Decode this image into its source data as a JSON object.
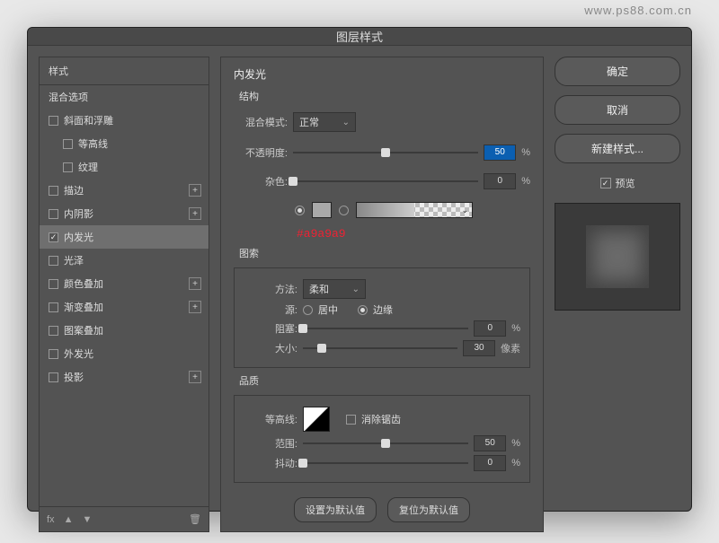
{
  "watermark": "www.ps88.com.cn",
  "dialog": {
    "title": "图层样式"
  },
  "left": {
    "header": "样式",
    "blend_options": "混合选项",
    "items": [
      {
        "label": "斜面和浮雕",
        "checked": false,
        "plus": false
      },
      {
        "label": "等高线",
        "checked": false,
        "plus": false,
        "indent": true
      },
      {
        "label": "纹理",
        "checked": false,
        "plus": false,
        "indent": true
      },
      {
        "label": "描边",
        "checked": false,
        "plus": true
      },
      {
        "label": "内阴影",
        "checked": false,
        "plus": true
      },
      {
        "label": "内发光",
        "checked": true,
        "plus": false,
        "selected": true
      },
      {
        "label": "光泽",
        "checked": false,
        "plus": false
      },
      {
        "label": "颜色叠加",
        "checked": false,
        "plus": true
      },
      {
        "label": "渐变叠加",
        "checked": false,
        "plus": true
      },
      {
        "label": "图案叠加",
        "checked": false,
        "plus": false
      },
      {
        "label": "外发光",
        "checked": false,
        "plus": false
      },
      {
        "label": "投影",
        "checked": false,
        "plus": true
      }
    ],
    "fx_label": "fx",
    "trash": "🗑"
  },
  "mid": {
    "title": "内发光",
    "struct_title": "结构",
    "blend_mode_label": "混合模式:",
    "blend_mode_value": "正常",
    "opacity_label": "不透明度:",
    "opacity_value": "50",
    "percent": "%",
    "noise_label": "杂色:",
    "noise_value": "0",
    "color_annotation": "#a9a9a9",
    "elements_title": "图索",
    "method_label": "方法:",
    "method_value": "柔和",
    "source_label": "源:",
    "source_center": "居中",
    "source_edge": "边缘",
    "choke_label": "阻塞:",
    "choke_value": "0",
    "size_label": "大小:",
    "size_value": "30",
    "px": "像素",
    "quality_title": "品质",
    "contour_label": "等高线:",
    "antialias": "消除锯齿",
    "range_label": "范围:",
    "range_value": "50",
    "jitter_label": "抖动:",
    "jitter_value": "0",
    "set_default": "设置为默认值",
    "reset_default": "复位为默认值"
  },
  "right": {
    "ok": "确定",
    "cancel": "取消",
    "new_style": "新建样式...",
    "preview": "预览"
  }
}
